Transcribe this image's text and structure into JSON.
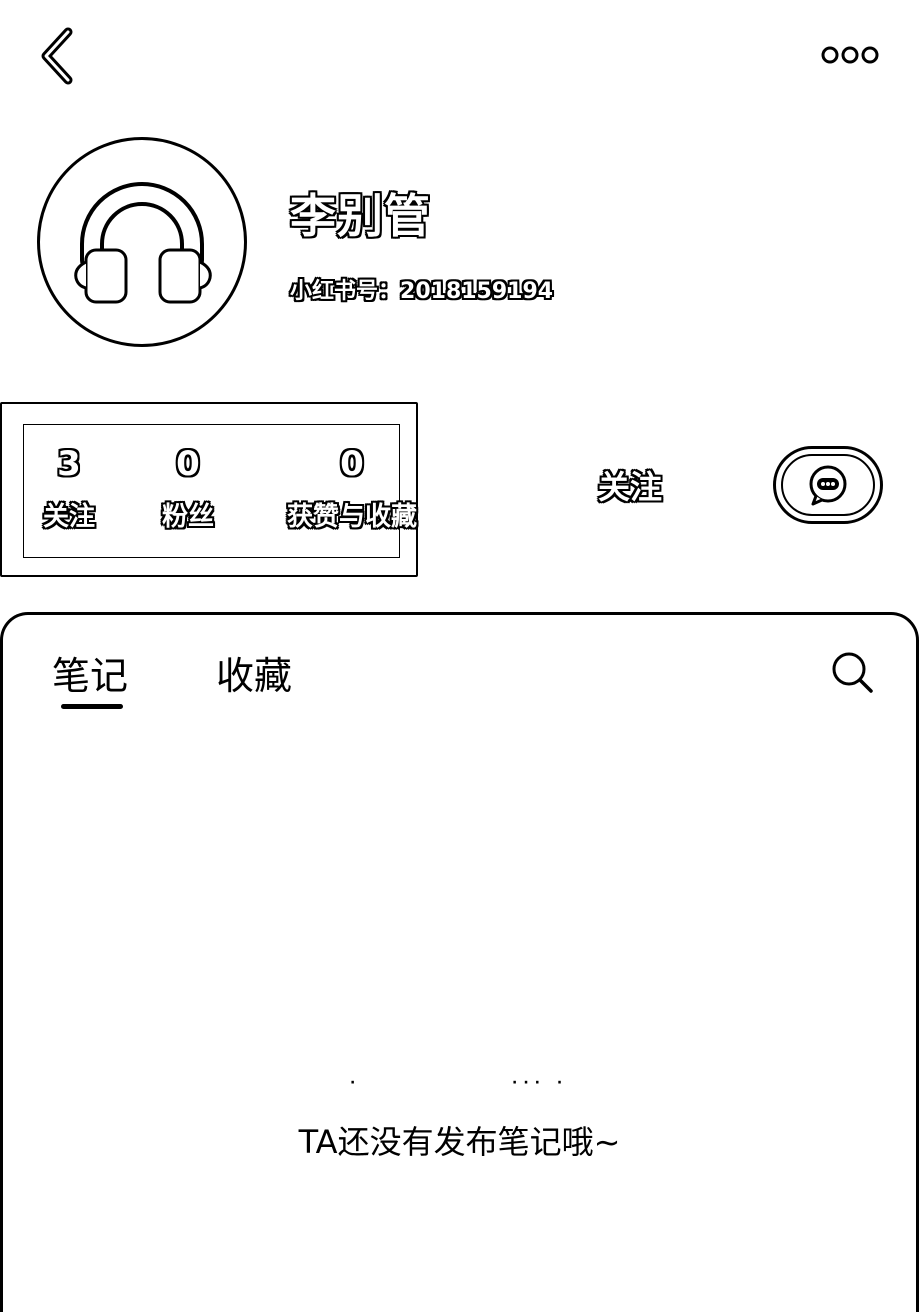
{
  "header": {
    "back_icon": "chevron-left-icon",
    "more_icon": "more-dots-icon"
  },
  "profile": {
    "avatar_icon": "headphones-icon",
    "name": "李别管",
    "id_label": "小红书号：",
    "id_value": "2018159194"
  },
  "stats": [
    {
      "value": "3",
      "label": "关注"
    },
    {
      "value": "0",
      "label": "粉丝"
    },
    {
      "value": "0",
      "label": "获赞与收藏"
    }
  ],
  "actions": {
    "follow_label": "关注",
    "chat_icon": "chat-bubble-icon"
  },
  "tabs": [
    {
      "label": "笔记",
      "active": true
    },
    {
      "label": "收藏",
      "active": false
    }
  ],
  "search_icon": "search-icon",
  "empty_state": {
    "message": "TA还没有发布笔记哦~"
  }
}
